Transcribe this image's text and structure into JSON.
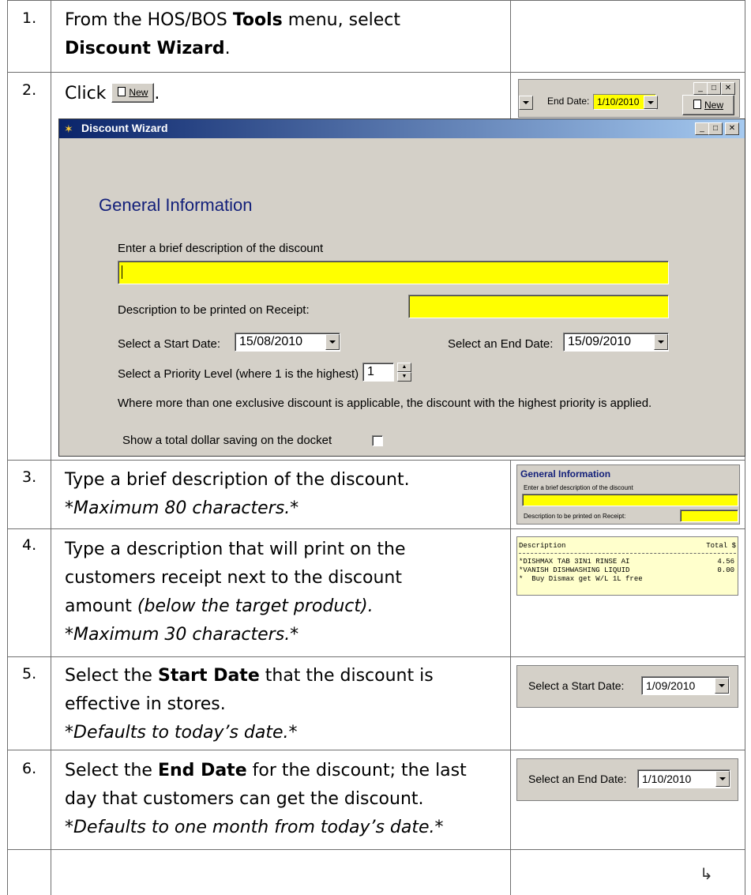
{
  "steps": [
    {
      "number": "1.",
      "line1_pre": "From the HOS/BOS ",
      "line1_bold": "Tools",
      "line1_post": " menu, select",
      "line2_bold": "Discount Wizard",
      "line2_post": "."
    },
    {
      "number": "2.",
      "pre": "Click ",
      "post": "."
    },
    {
      "number": "3.",
      "line1": "Type a brief description of the discount.",
      "note": "*Maximum 80 characters.*"
    },
    {
      "number": "4.",
      "line1": "Type a description that will print on the",
      "line2": "customers receipt next to the discount",
      "line3_pre": "amount ",
      "line3_italic": "(below the target product).",
      "note": "*Maximum 30 characters.*"
    },
    {
      "number": "5.",
      "line1_pre": "Select the ",
      "line1_bold": "Start Date",
      "line1_post": " that the discount is",
      "line2": "effective in stores.",
      "note": "*Defaults to today’s date.*"
    },
    {
      "number": "6.",
      "line1_pre": "Select the ",
      "line1_bold": "End Date",
      "line1_post": " for the discount; the last",
      "line2": "day that customers can get the discount.",
      "note": "*Defaults to one month from today’s date.*"
    }
  ],
  "new_button_label": "New",
  "step2_shot": {
    "end_date_label": "End Date:",
    "end_date_value": "1/10/2010",
    "new_label": "New"
  },
  "wizard": {
    "title": "Discount Wizard",
    "heading": "General Information",
    "brief_desc_label": "Enter a brief description of the discount",
    "receipt_desc_label": "Description to be printed on Receipt:",
    "start_date_label": "Select a Start Date:",
    "start_date_value": "15/08/2010",
    "end_date_label": "Select an End Date:",
    "end_date_value": "15/09/2010",
    "priority_label": "Select a Priority Level (where 1 is the highest)",
    "priority_value": "1",
    "exclusive_note": "Where more than one exclusive discount is applicable, the discount with the highest priority is applied.",
    "dollar_saving_label": "Show a total dollar saving on the docket"
  },
  "step3_shot": {
    "heading": "General Information",
    "brief_label": "Enter a brief description of the discount",
    "receipt_label": "Description to be printed on Receipt:"
  },
  "receipt": {
    "header_desc": "Description",
    "header_total": "Total $",
    "rows": [
      {
        "desc": "*DISHMAX TAB 3IN1 RINSE AI",
        "total": "4.56"
      },
      {
        "desc": "*VANISH DISHWASHING LIQUID",
        "total": "0.00"
      },
      {
        "desc": "*  Buy Dismax get W/L 1L free",
        "total": ""
      }
    ]
  },
  "step5_shot": {
    "label": "Select a Start Date:",
    "value": "1/09/2010"
  },
  "step6_shot": {
    "label": "Select an End Date:",
    "value": "1/10/2010"
  },
  "colors": {
    "accent_yellow": "#ffff00",
    "title_bar_start": "#0a246a",
    "title_bar_end": "#a6caf0",
    "heading_blue": "#13207a"
  }
}
